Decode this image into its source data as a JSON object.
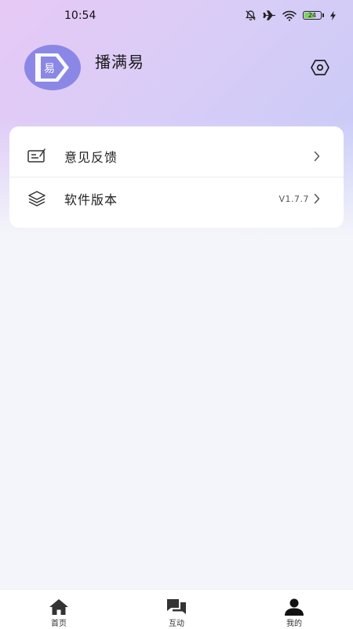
{
  "status_bar": {
    "time": "10:54",
    "battery_level": "24"
  },
  "profile": {
    "app_name": "播满易",
    "avatar_glyph": "易"
  },
  "menu": {
    "items": [
      {
        "label": "意见反馈",
        "value": "",
        "icon": "feedback-icon"
      },
      {
        "label": "软件版本",
        "value": "V1.7.7",
        "icon": "layers-icon"
      }
    ]
  },
  "bottom_nav": {
    "items": [
      {
        "label": "首页",
        "icon": "home-icon"
      },
      {
        "label": "互动",
        "icon": "chat-icon"
      },
      {
        "label": "我的",
        "icon": "user-icon"
      }
    ]
  },
  "colors": {
    "accent": "#8b87e6",
    "battery": "#7dd35b"
  }
}
